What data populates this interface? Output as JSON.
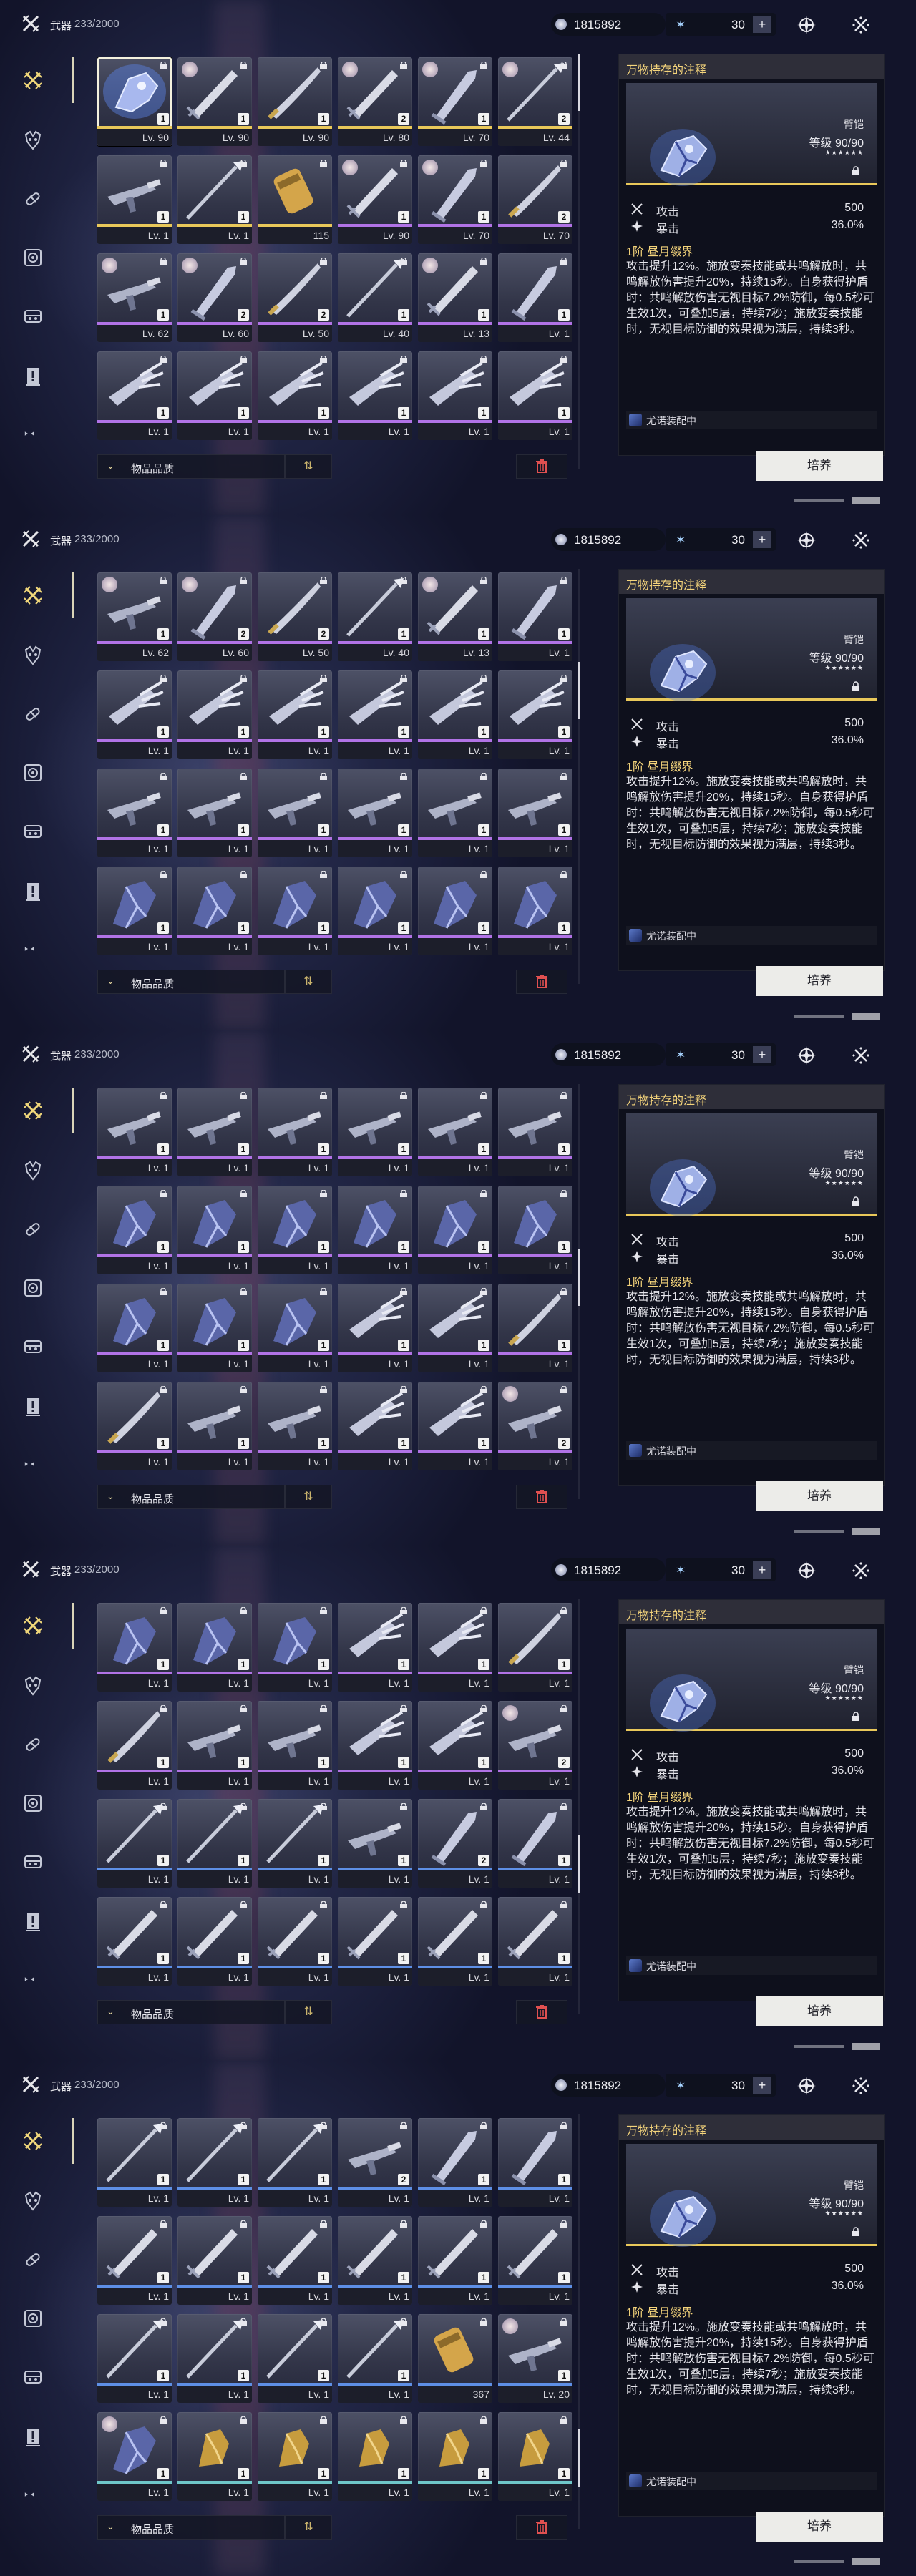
{
  "screens": [
    {
      "category": {
        "label": "武器",
        "count": "233/2000"
      },
      "currency": {
        "value": "1815892",
        "energy": "30",
        "plus": "+"
      },
      "filter": {
        "label": "物品品质"
      },
      "detail": {
        "name": "万物持存的注释",
        "type": "臂铠",
        "level_label": "等级",
        "level_value": "90",
        "level_max": "/90",
        "stars": "★★★★★★",
        "stats": [
          {
            "name": "攻击",
            "value": "500"
          },
          {
            "name": "暴击",
            "value": "36.0%"
          }
        ],
        "rank": "1阶 昼月缀界",
        "desc": "攻击提升12%。施放变奏技能或共鸣解放时，共鸣解放伤害提升20%，持续15秒。自身获得护盾时：共鸣解放伤害无视目标7.2%防御，每0.5秒可生效1次，可叠加5层，持续7秒；施放变奏技能时，无视目标防御的效果视为满层，持续3秒。",
        "equipped": "尤诺装配中"
      },
      "cultivate": "培养",
      "items": [
        {
          "lv": "Lv. 90",
          "ct": "1",
          "rar": "gold",
          "sel": true,
          "wp": "art"
        },
        {
          "lv": "Lv. 90",
          "ct": "1",
          "rar": "gold",
          "av": true,
          "wp": "sword"
        },
        {
          "lv": "Lv. 90",
          "ct": "1",
          "rar": "gold",
          "wp": "saber"
        },
        {
          "lv": "Lv. 80",
          "ct": "2",
          "rar": "gold",
          "av": true,
          "wp": "sword"
        },
        {
          "lv": "Lv. 70",
          "ct": "1",
          "rar": "gold",
          "av": true,
          "wp": "blade"
        },
        {
          "lv": "Lv. 44",
          "ct": "2",
          "rar": "gold",
          "av": true,
          "wp": "spear"
        },
        {
          "lv": "Lv. 1",
          "ct": "1",
          "rar": "gold",
          "wp": "gun"
        },
        {
          "lv": "Lv. 1",
          "ct": "1",
          "rar": "gold",
          "wp": "spear"
        },
        {
          "lv": "115",
          "ct": "",
          "rar": "gold",
          "wp": "cylinder"
        },
        {
          "lv": "Lv. 90",
          "ct": "1",
          "rar": "purple",
          "av": true,
          "wp": "sword"
        },
        {
          "lv": "Lv. 70",
          "ct": "1",
          "rar": "purple",
          "av": true,
          "wp": "blade"
        },
        {
          "lv": "Lv. 70",
          "ct": "2",
          "rar": "purple",
          "wp": "saber"
        },
        {
          "lv": "Lv. 62",
          "ct": "1",
          "rar": "purple",
          "av": true,
          "wp": "gun"
        },
        {
          "lv": "Lv. 60",
          "ct": "2",
          "rar": "purple",
          "av": true,
          "wp": "blade"
        },
        {
          "lv": "Lv. 50",
          "ct": "2",
          "rar": "purple",
          "wp": "saber"
        },
        {
          "lv": "Lv. 40",
          "ct": "1",
          "rar": "purple",
          "wp": "spear"
        },
        {
          "lv": "Lv. 13",
          "ct": "1",
          "rar": "purple",
          "av": true,
          "wp": "sword"
        },
        {
          "lv": "Lv. 1",
          "ct": "1",
          "rar": "purple",
          "wp": "blade"
        },
        {
          "lv": "Lv. 1",
          "ct": "1",
          "rar": "purple",
          "wp": "claw"
        },
        {
          "lv": "Lv. 1",
          "ct": "1",
          "rar": "purple",
          "wp": "claw"
        },
        {
          "lv": "Lv. 1",
          "ct": "1",
          "rar": "purple",
          "wp": "claw"
        },
        {
          "lv": "Lv. 1",
          "ct": "1",
          "rar": "purple",
          "wp": "claw"
        },
        {
          "lv": "Lv. 1",
          "ct": "1",
          "rar": "purple",
          "wp": "claw"
        },
        {
          "lv": "Lv. 1",
          "ct": "1",
          "rar": "purple",
          "wp": "claw"
        }
      ]
    },
    {
      "category": {
        "label": "武器",
        "count": "233/2000"
      },
      "currency": {
        "value": "1815892",
        "energy": "30",
        "plus": "+"
      },
      "filter": {
        "label": "物品品质"
      },
      "detail": {
        "name": "万物持存的注释",
        "type": "臂铠",
        "level_label": "等级",
        "level_value": "90",
        "level_max": "/90",
        "stars": "★★★★★★",
        "stats": [
          {
            "name": "攻击",
            "value": "500"
          },
          {
            "name": "暴击",
            "value": "36.0%"
          }
        ],
        "rank": "1阶 昼月缀界",
        "desc": "攻击提升12%。施放变奏技能或共鸣解放时，共鸣解放伤害提升20%，持续15秒。自身获得护盾时：共鸣解放伤害无视目标7.2%防御，每0.5秒可生效1次，可叠加5层，持续7秒；施放变奏技能时，无视目标防御的效果视为满层，持续3秒。",
        "equipped": "尤诺装配中"
      },
      "cultivate": "培养",
      "items": [
        {
          "lv": "Lv. 62",
          "ct": "1",
          "rar": "purple",
          "av": true,
          "wp": "gun"
        },
        {
          "lv": "Lv. 60",
          "ct": "2",
          "rar": "purple",
          "av": true,
          "wp": "blade"
        },
        {
          "lv": "Lv. 50",
          "ct": "2",
          "rar": "purple",
          "wp": "saber"
        },
        {
          "lv": "Lv. 40",
          "ct": "1",
          "rar": "purple",
          "wp": "spear"
        },
        {
          "lv": "Lv. 13",
          "ct": "1",
          "rar": "purple",
          "av": true,
          "wp": "sword"
        },
        {
          "lv": "Lv. 1",
          "ct": "1",
          "rar": "purple",
          "wp": "blade"
        },
        {
          "lv": "Lv. 1",
          "ct": "1",
          "rar": "purple",
          "wp": "claw"
        },
        {
          "lv": "Lv. 1",
          "ct": "1",
          "rar": "purple",
          "wp": "claw"
        },
        {
          "lv": "Lv. 1",
          "ct": "1",
          "rar": "purple",
          "wp": "claw"
        },
        {
          "lv": "Lv. 1",
          "ct": "1",
          "rar": "purple",
          "wp": "claw"
        },
        {
          "lv": "Lv. 1",
          "ct": "1",
          "rar": "purple",
          "wp": "claw"
        },
        {
          "lv": "Lv. 1",
          "ct": "1",
          "rar": "purple",
          "wp": "claw"
        },
        {
          "lv": "Lv. 1",
          "ct": "1",
          "rar": "purple",
          "wp": "gun"
        },
        {
          "lv": "Lv. 1",
          "ct": "1",
          "rar": "purple",
          "wp": "gun"
        },
        {
          "lv": "Lv. 1",
          "ct": "1",
          "rar": "purple",
          "wp": "gun"
        },
        {
          "lv": "Lv. 1",
          "ct": "1",
          "rar": "purple",
          "wp": "gun"
        },
        {
          "lv": "Lv. 1",
          "ct": "1",
          "rar": "purple",
          "wp": "gun"
        },
        {
          "lv": "Lv. 1",
          "ct": "1",
          "rar": "purple",
          "wp": "gun"
        },
        {
          "lv": "Lv. 1",
          "ct": "1",
          "rar": "purple",
          "wp": "gauntlet"
        },
        {
          "lv": "Lv. 1",
          "ct": "1",
          "rar": "purple",
          "wp": "gauntlet"
        },
        {
          "lv": "Lv. 1",
          "ct": "1",
          "rar": "purple",
          "wp": "gauntlet"
        },
        {
          "lv": "Lv. 1",
          "ct": "1",
          "rar": "purple",
          "wp": "gauntlet"
        },
        {
          "lv": "Lv. 1",
          "ct": "1",
          "rar": "purple",
          "wp": "gauntlet"
        },
        {
          "lv": "Lv. 1",
          "ct": "1",
          "rar": "purple",
          "wp": "gauntlet"
        }
      ]
    },
    {
      "category": {
        "label": "武器",
        "count": "233/2000"
      },
      "currency": {
        "value": "1815892",
        "energy": "30",
        "plus": "+"
      },
      "filter": {
        "label": "物品品质"
      },
      "detail": {
        "name": "万物持存的注释",
        "type": "臂铠",
        "level_label": "等级",
        "level_value": "90",
        "level_max": "/90",
        "stars": "★★★★★★",
        "stats": [
          {
            "name": "攻击",
            "value": "500"
          },
          {
            "name": "暴击",
            "value": "36.0%"
          }
        ],
        "rank": "1阶 昼月缀界",
        "desc": "攻击提升12%。施放变奏技能或共鸣解放时，共鸣解放伤害提升20%，持续15秒。自身获得护盾时：共鸣解放伤害无视目标7.2%防御，每0.5秒可生效1次，可叠加5层，持续7秒；施放变奏技能时，无视目标防御的效果视为满层，持续3秒。",
        "equipped": "尤诺装配中"
      },
      "cultivate": "培养",
      "items": [
        {
          "lv": "Lv. 1",
          "ct": "1",
          "rar": "purple",
          "wp": "gun"
        },
        {
          "lv": "Lv. 1",
          "ct": "1",
          "rar": "purple",
          "wp": "gun"
        },
        {
          "lv": "Lv. 1",
          "ct": "1",
          "rar": "purple",
          "wp": "gun"
        },
        {
          "lv": "Lv. 1",
          "ct": "1",
          "rar": "purple",
          "wp": "gun"
        },
        {
          "lv": "Lv. 1",
          "ct": "1",
          "rar": "purple",
          "wp": "gun"
        },
        {
          "lv": "Lv. 1",
          "ct": "1",
          "rar": "purple",
          "wp": "gun"
        },
        {
          "lv": "Lv. 1",
          "ct": "1",
          "rar": "purple",
          "wp": "gauntlet"
        },
        {
          "lv": "Lv. 1",
          "ct": "1",
          "rar": "purple",
          "wp": "gauntlet"
        },
        {
          "lv": "Lv. 1",
          "ct": "1",
          "rar": "purple",
          "wp": "gauntlet"
        },
        {
          "lv": "Lv. 1",
          "ct": "1",
          "rar": "purple",
          "wp": "gauntlet"
        },
        {
          "lv": "Lv. 1",
          "ct": "1",
          "rar": "purple",
          "wp": "gauntlet"
        },
        {
          "lv": "Lv. 1",
          "ct": "1",
          "rar": "purple",
          "wp": "gauntlet"
        },
        {
          "lv": "Lv. 1",
          "ct": "1",
          "rar": "purple",
          "wp": "gauntlet"
        },
        {
          "lv": "Lv. 1",
          "ct": "1",
          "rar": "purple",
          "wp": "gauntlet"
        },
        {
          "lv": "Lv. 1",
          "ct": "1",
          "rar": "purple",
          "wp": "gauntlet"
        },
        {
          "lv": "Lv. 1",
          "ct": "1",
          "rar": "purple",
          "wp": "claw"
        },
        {
          "lv": "Lv. 1",
          "ct": "1",
          "rar": "purple",
          "wp": "claw"
        },
        {
          "lv": "Lv. 1",
          "ct": "1",
          "rar": "purple",
          "wp": "saber"
        },
        {
          "lv": "Lv. 1",
          "ct": "1",
          "rar": "purple",
          "wp": "saber"
        },
        {
          "lv": "Lv. 1",
          "ct": "1",
          "rar": "purple",
          "wp": "gun"
        },
        {
          "lv": "Lv. 1",
          "ct": "1",
          "rar": "purple",
          "wp": "gun"
        },
        {
          "lv": "Lv. 1",
          "ct": "1",
          "rar": "purple",
          "wp": "claw"
        },
        {
          "lv": "Lv. 1",
          "ct": "1",
          "rar": "purple",
          "wp": "claw"
        },
        {
          "lv": "Lv. 1",
          "ct": "2",
          "rar": "purple",
          "av": true,
          "wp": "gun"
        }
      ]
    },
    {
      "category": {
        "label": "武器",
        "count": "233/2000"
      },
      "currency": {
        "value": "1815892",
        "energy": "30",
        "plus": "+"
      },
      "filter": {
        "label": "物品品质"
      },
      "detail": {
        "name": "万物持存的注释",
        "type": "臂铠",
        "level_label": "等级",
        "level_value": "90",
        "level_max": "/90",
        "stars": "★★★★★★",
        "stats": [
          {
            "name": "攻击",
            "value": "500"
          },
          {
            "name": "暴击",
            "value": "36.0%"
          }
        ],
        "rank": "1阶 昼月缀界",
        "desc": "攻击提升12%。施放变奏技能或共鸣解放时，共鸣解放伤害提升20%，持续15秒。自身获得护盾时：共鸣解放伤害无视目标7.2%防御，每0.5秒可生效1次，可叠加5层，持续7秒；施放变奏技能时，无视目标防御的效果视为满层，持续3秒。",
        "equipped": "尤诺装配中"
      },
      "cultivate": "培养",
      "items": [
        {
          "lv": "Lv. 1",
          "ct": "1",
          "rar": "purple",
          "wp": "gauntlet"
        },
        {
          "lv": "Lv. 1",
          "ct": "1",
          "rar": "purple",
          "wp": "gauntlet"
        },
        {
          "lv": "Lv. 1",
          "ct": "1",
          "rar": "purple",
          "wp": "gauntlet"
        },
        {
          "lv": "Lv. 1",
          "ct": "1",
          "rar": "purple",
          "wp": "claw"
        },
        {
          "lv": "Lv. 1",
          "ct": "1",
          "rar": "purple",
          "wp": "claw"
        },
        {
          "lv": "Lv. 1",
          "ct": "1",
          "rar": "purple",
          "wp": "saber"
        },
        {
          "lv": "Lv. 1",
          "ct": "1",
          "rar": "purple",
          "wp": "saber"
        },
        {
          "lv": "Lv. 1",
          "ct": "1",
          "rar": "purple",
          "wp": "gun"
        },
        {
          "lv": "Lv. 1",
          "ct": "1",
          "rar": "purple",
          "wp": "gun"
        },
        {
          "lv": "Lv. 1",
          "ct": "1",
          "rar": "purple",
          "wp": "claw"
        },
        {
          "lv": "Lv. 1",
          "ct": "1",
          "rar": "purple",
          "wp": "claw"
        },
        {
          "lv": "Lv. 1",
          "ct": "2",
          "rar": "purple",
          "av": true,
          "wp": "gun"
        },
        {
          "lv": "Lv. 1",
          "ct": "1",
          "rar": "blue",
          "wp": "spear"
        },
        {
          "lv": "Lv. 1",
          "ct": "1",
          "rar": "blue",
          "wp": "spear"
        },
        {
          "lv": "Lv. 1",
          "ct": "1",
          "rar": "blue",
          "wp": "spear"
        },
        {
          "lv": "Lv. 1",
          "ct": "1",
          "rar": "blue",
          "wp": "gun"
        },
        {
          "lv": "Lv. 1",
          "ct": "2",
          "rar": "blue",
          "wp": "blade"
        },
        {
          "lv": "Lv. 1",
          "ct": "1",
          "rar": "blue",
          "wp": "blade"
        },
        {
          "lv": "Lv. 1",
          "ct": "1",
          "rar": "blue",
          "wp": "sword"
        },
        {
          "lv": "Lv. 1",
          "ct": "1",
          "rar": "blue",
          "wp": "sword"
        },
        {
          "lv": "Lv. 1",
          "ct": "1",
          "rar": "blue",
          "wp": "sword"
        },
        {
          "lv": "Lv. 1",
          "ct": "1",
          "rar": "blue",
          "wp": "sword"
        },
        {
          "lv": "Lv. 1",
          "ct": "1",
          "rar": "blue",
          "wp": "sword"
        },
        {
          "lv": "Lv. 1",
          "ct": "1",
          "rar": "blue",
          "wp": "sword"
        }
      ]
    },
    {
      "category": {
        "label": "武器",
        "count": "233/2000"
      },
      "currency": {
        "value": "1815892",
        "energy": "30",
        "plus": "+"
      },
      "filter": {
        "label": "物品品质"
      },
      "detail": {
        "name": "万物持存的注释",
        "type": "臂铠",
        "level_label": "等级",
        "level_value": "90",
        "level_max": "/90",
        "stars": "★★★★★★",
        "stats": [
          {
            "name": "攻击",
            "value": "500"
          },
          {
            "name": "暴击",
            "value": "36.0%"
          }
        ],
        "rank": "1阶 昼月缀界",
        "desc": "攻击提升12%。施放变奏技能或共鸣解放时，共鸣解放伤害提升20%，持续15秒。自身获得护盾时：共鸣解放伤害无视目标7.2%防御，每0.5秒可生效1次，可叠加5层，持续7秒；施放变奏技能时，无视目标防御的效果视为满层，持续3秒。",
        "equipped": "尤诺装配中"
      },
      "cultivate": "培养",
      "items": [
        {
          "lv": "Lv. 1",
          "ct": "1",
          "rar": "blue",
          "wp": "spear"
        },
        {
          "lv": "Lv. 1",
          "ct": "1",
          "rar": "blue",
          "wp": "spear"
        },
        {
          "lv": "Lv. 1",
          "ct": "1",
          "rar": "blue",
          "wp": "spear"
        },
        {
          "lv": "Lv. 1",
          "ct": "2",
          "rar": "blue",
          "wp": "gun"
        },
        {
          "lv": "Lv. 1",
          "ct": "1",
          "rar": "blue",
          "wp": "blade"
        },
        {
          "lv": "Lv. 1",
          "ct": "1",
          "rar": "blue",
          "wp": "blade"
        },
        {
          "lv": "Lv. 1",
          "ct": "1",
          "rar": "blue",
          "wp": "sword"
        },
        {
          "lv": "Lv. 1",
          "ct": "1",
          "rar": "blue",
          "wp": "sword"
        },
        {
          "lv": "Lv. 1",
          "ct": "1",
          "rar": "blue",
          "wp": "sword"
        },
        {
          "lv": "Lv. 1",
          "ct": "1",
          "rar": "blue",
          "wp": "sword"
        },
        {
          "lv": "Lv. 1",
          "ct": "1",
          "rar": "blue",
          "wp": "sword"
        },
        {
          "lv": "Lv. 1",
          "ct": "1",
          "rar": "blue",
          "wp": "sword"
        },
        {
          "lv": "Lv. 1",
          "ct": "1",
          "rar": "blue",
          "wp": "spear"
        },
        {
          "lv": "Lv. 1",
          "ct": "1",
          "rar": "blue",
          "wp": "spear"
        },
        {
          "lv": "Lv. 1",
          "ct": "1",
          "rar": "blue",
          "wp": "spear"
        },
        {
          "lv": "Lv. 1",
          "ct": "1",
          "rar": "blue",
          "wp": "spear"
        },
        {
          "lv": "367",
          "ct": "",
          "rar": "blue",
          "wp": "cylinder"
        },
        {
          "lv": "Lv. 20",
          "ct": "1",
          "rar": "blue",
          "av": true,
          "wp": "gun"
        },
        {
          "lv": "Lv. 1",
          "ct": "1",
          "rar": "teal",
          "av": true,
          "wp": "gauntlet"
        },
        {
          "lv": "Lv. 1",
          "ct": "1",
          "rar": "teal",
          "wp": "gold"
        },
        {
          "lv": "Lv. 1",
          "ct": "1",
          "rar": "teal",
          "wp": "gold"
        },
        {
          "lv": "Lv. 1",
          "ct": "1",
          "rar": "teal",
          "wp": "gold"
        },
        {
          "lv": "Lv. 1",
          "ct": "1",
          "rar": "teal",
          "wp": "gold"
        },
        {
          "lv": "Lv. 1",
          "ct": "1",
          "rar": "teal",
          "wp": "gold"
        }
      ]
    }
  ],
  "colors": {
    "gold": "#e9c85a",
    "purple": "#b173e6",
    "blue": "#5e8fe6",
    "teal": "#6fc7c9",
    "accent": "#f4d47b"
  }
}
